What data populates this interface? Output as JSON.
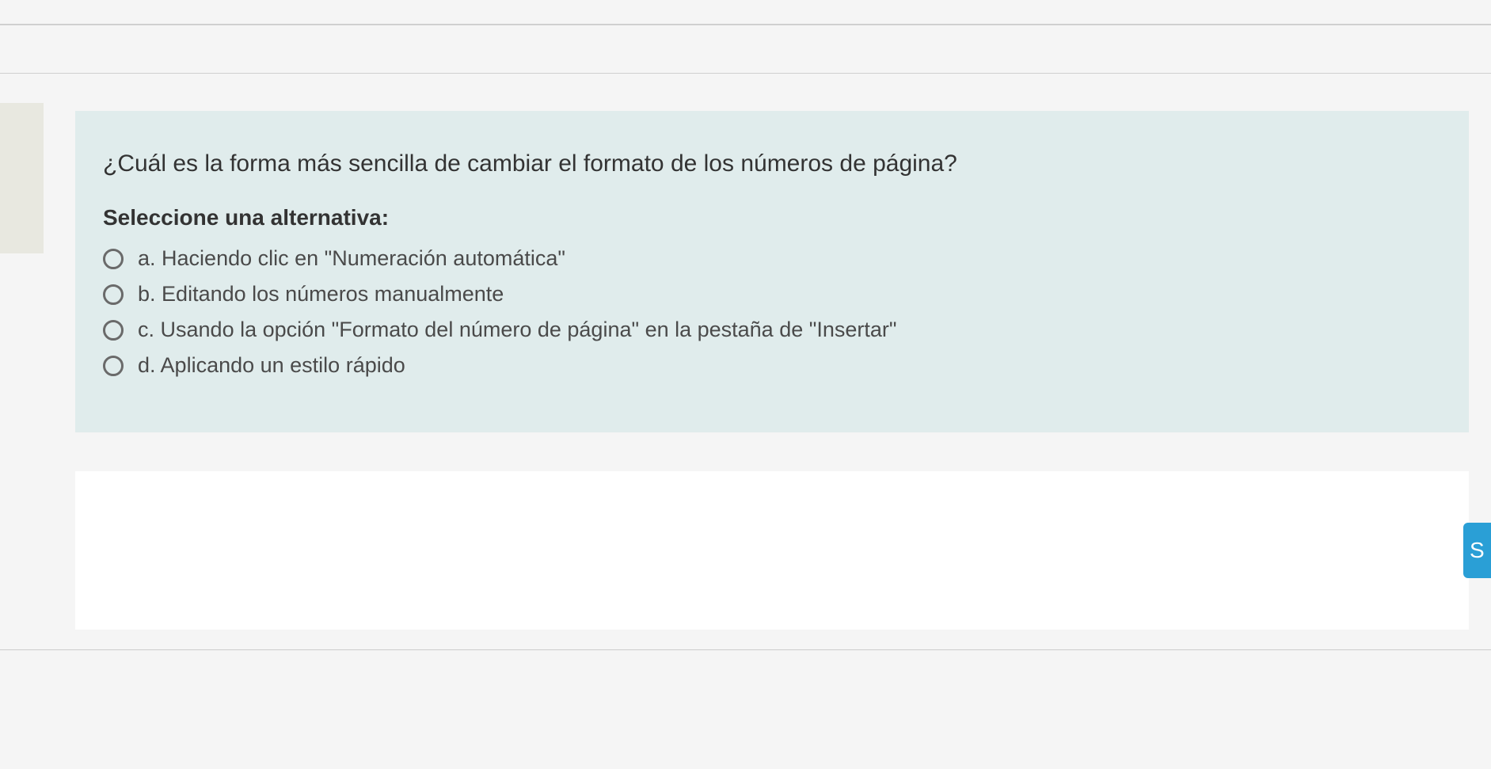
{
  "question": {
    "text": "¿Cuál es la forma más sencilla de cambiar el formato de los números de página?",
    "instruction": "Seleccione una alternativa:",
    "options": [
      {
        "letter": "a.",
        "text": "Haciendo clic en \"Numeración automática\""
      },
      {
        "letter": "b.",
        "text": "Editando los números manualmente"
      },
      {
        "letter": "c.",
        "text": "Usando la opción \"Formato del número de página\" en la pestaña de \"Insertar\""
      },
      {
        "letter": "d.",
        "text": "Aplicando un estilo rápido"
      }
    ]
  },
  "submit": {
    "label": "S"
  }
}
